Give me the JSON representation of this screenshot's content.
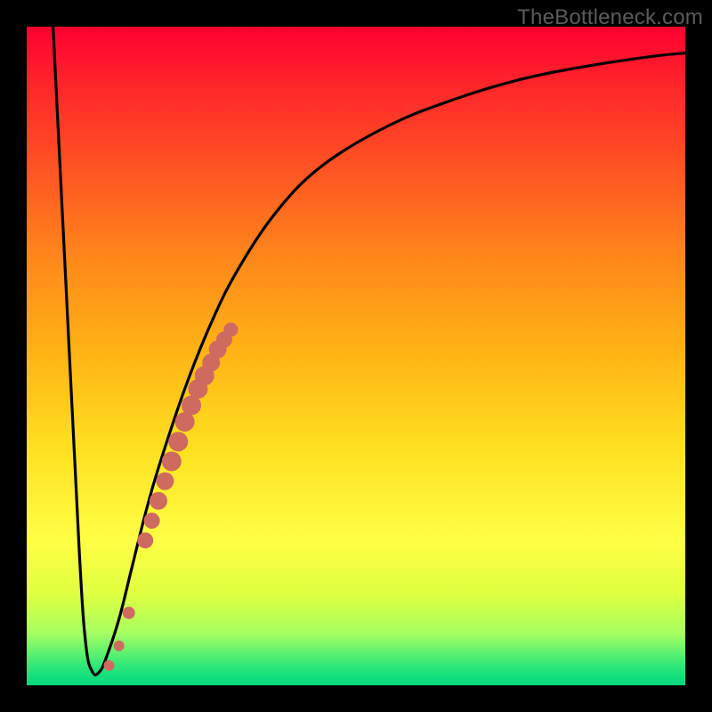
{
  "watermark": "TheBottleneck.com",
  "colors": {
    "frame": "#000000",
    "curve": "#000000",
    "marker": "#cf6a60"
  },
  "chart_data": {
    "type": "line",
    "title": "",
    "xlabel": "",
    "ylabel": "",
    "xlim": [
      0,
      100
    ],
    "ylim": [
      0,
      100
    ],
    "grid": false,
    "series": [
      {
        "name": "main-curve",
        "x": [
          4,
          6,
          8,
          9,
          10,
          11,
          12,
          14,
          16,
          18,
          20,
          24,
          28,
          32,
          38,
          45,
          55,
          65,
          75,
          85,
          95,
          100
        ],
        "y": [
          100,
          60,
          20,
          6,
          2,
          2,
          4,
          10,
          18,
          26,
          33,
          45,
          55,
          63,
          72,
          79,
          85,
          89,
          92,
          94,
          95.5,
          96
        ]
      }
    ],
    "markers": {
      "name": "highlight-points",
      "x": [
        12.5,
        14.0,
        15.5,
        18.0,
        19.0,
        20.0,
        21.0,
        22.0,
        23.0,
        24.0,
        25.0,
        26.0,
        27.0,
        28.0,
        29.0,
        30.0,
        31.0
      ],
      "y": [
        3.0,
        6.0,
        11.0,
        22.0,
        25.0,
        28.0,
        31.0,
        34.0,
        37.0,
        40.0,
        42.5,
        45.0,
        47.0,
        49.0,
        51.0,
        52.5,
        54.0
      ],
      "r": [
        6,
        6,
        7,
        9,
        9,
        10,
        10,
        11,
        11,
        11,
        11,
        11,
        11,
        10,
        10,
        9,
        8
      ]
    }
  }
}
